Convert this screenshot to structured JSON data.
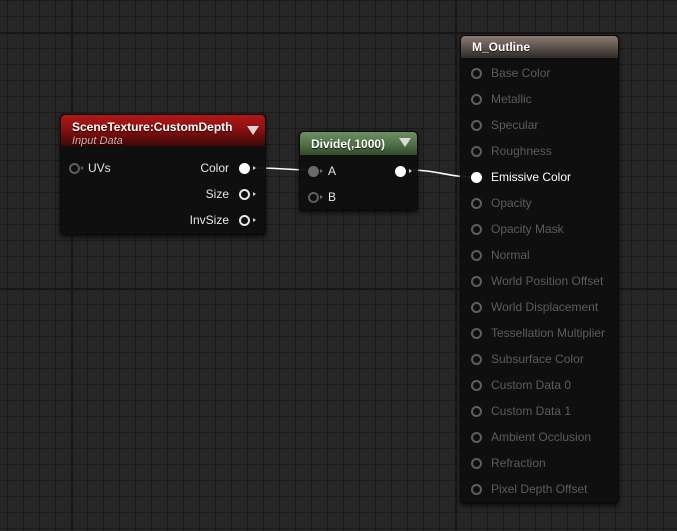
{
  "nodes": {
    "scene_texture": {
      "title": "SceneTexture:CustomDepth",
      "subtitle": "Input Data",
      "inputs": [
        {
          "label": "UVs"
        }
      ],
      "outputs": [
        {
          "label": "Color"
        },
        {
          "label": "Size"
        },
        {
          "label": "InvSize"
        }
      ]
    },
    "divide": {
      "title": "Divide(,1000)",
      "inputs": [
        {
          "label": "A"
        },
        {
          "label": "B"
        }
      ]
    },
    "material_output": {
      "title": "M_Outline",
      "pins": [
        {
          "label": "Base Color",
          "active": false
        },
        {
          "label": "Metallic",
          "active": false
        },
        {
          "label": "Specular",
          "active": false
        },
        {
          "label": "Roughness",
          "active": false
        },
        {
          "label": "Emissive Color",
          "active": true
        },
        {
          "label": "Opacity",
          "active": false
        },
        {
          "label": "Opacity Mask",
          "active": false
        },
        {
          "label": "Normal",
          "active": false
        },
        {
          "label": "World Position Offset",
          "active": false
        },
        {
          "label": "World Displacement",
          "active": false
        },
        {
          "label": "Tessellation Multiplier",
          "active": false
        },
        {
          "label": "Subsurface Color",
          "active": false
        },
        {
          "label": "Custom Data 0",
          "active": false
        },
        {
          "label": "Custom Data 1",
          "active": false
        },
        {
          "label": "Ambient Occlusion",
          "active": false
        },
        {
          "label": "Refraction",
          "active": false
        },
        {
          "label": "Pixel Depth Offset",
          "active": false
        }
      ]
    }
  },
  "colors": {
    "graph_background": "#262626",
    "scene_texture_header": "#8b1010",
    "divide_header": "#4f7046",
    "output_header": "#5e534d",
    "wire": "#ffffff",
    "inactive_pin_text": "#5c5c5c"
  }
}
